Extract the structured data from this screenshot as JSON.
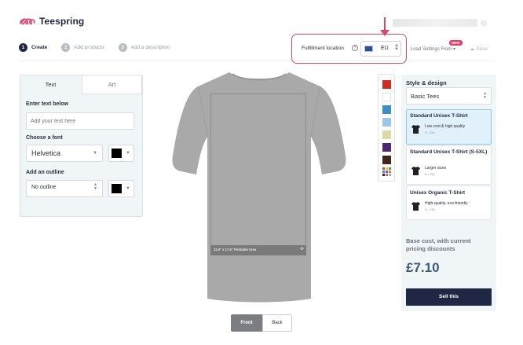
{
  "brand": {
    "name": "Teespring",
    "logo_color": "#e53d6a"
  },
  "steps": [
    {
      "num": "1",
      "label": "Create",
      "active": true
    },
    {
      "num": "2",
      "label": "Add products",
      "active": false
    },
    {
      "num": "3",
      "label": "Add a description",
      "active": false
    }
  ],
  "fulfillment": {
    "label": "Fulfillment location",
    "help_icon": "?",
    "value": "EU",
    "highlight_color": "#d24a6c"
  },
  "toolbar": {
    "load_settings_label": "Load Settings From",
    "new_badge": "NEW",
    "save_label": "Save"
  },
  "left_panel": {
    "tabs": [
      {
        "label": "Text",
        "active": true
      },
      {
        "label": "Art",
        "active": false
      }
    ],
    "enter_text_label": "Enter text below",
    "text_placeholder": "Add your text here",
    "choose_font_label": "Choose a font",
    "font_value": "Helvetica",
    "font_color": "#000000",
    "outline_label": "Add an outline",
    "outline_value": "No outline",
    "outline_color": "#000000"
  },
  "canvas": {
    "shirt_color": "#a9a9a9",
    "printable_area_label": "11.9\" x 17.9\" Printable Area",
    "zoom_icon": "⊕",
    "view_buttons": {
      "front": "Front",
      "back": "Back"
    }
  },
  "palette": {
    "colors": [
      "#cc2c1f",
      "#ffffff",
      "#3a8fc5",
      "#9cc7e6",
      "#dcd9a7",
      "#4b2770",
      "#40261a"
    ]
  },
  "right_panel": {
    "title": "Style & design",
    "style_value": "Basic Tees",
    "products": [
      {
        "name": "Standard Unisex T-Shirt",
        "desc": "Low cost & high quality",
        "sizes": "S - 3XL",
        "selected": true
      },
      {
        "name": "Standard Unisex T-Shirt (S-5XL)",
        "desc": "Larger sizes",
        "sizes": "S - 5XL",
        "selected": false
      },
      {
        "name": "Unisex Organic T-Shirt",
        "desc": "High-quality, eco-friendly",
        "sizes": "S - 2XL",
        "selected": false
      }
    ],
    "base_cost_label": "Base cost, with current pricing discounts",
    "price": "£7.10",
    "sell_button": "Sell this"
  }
}
